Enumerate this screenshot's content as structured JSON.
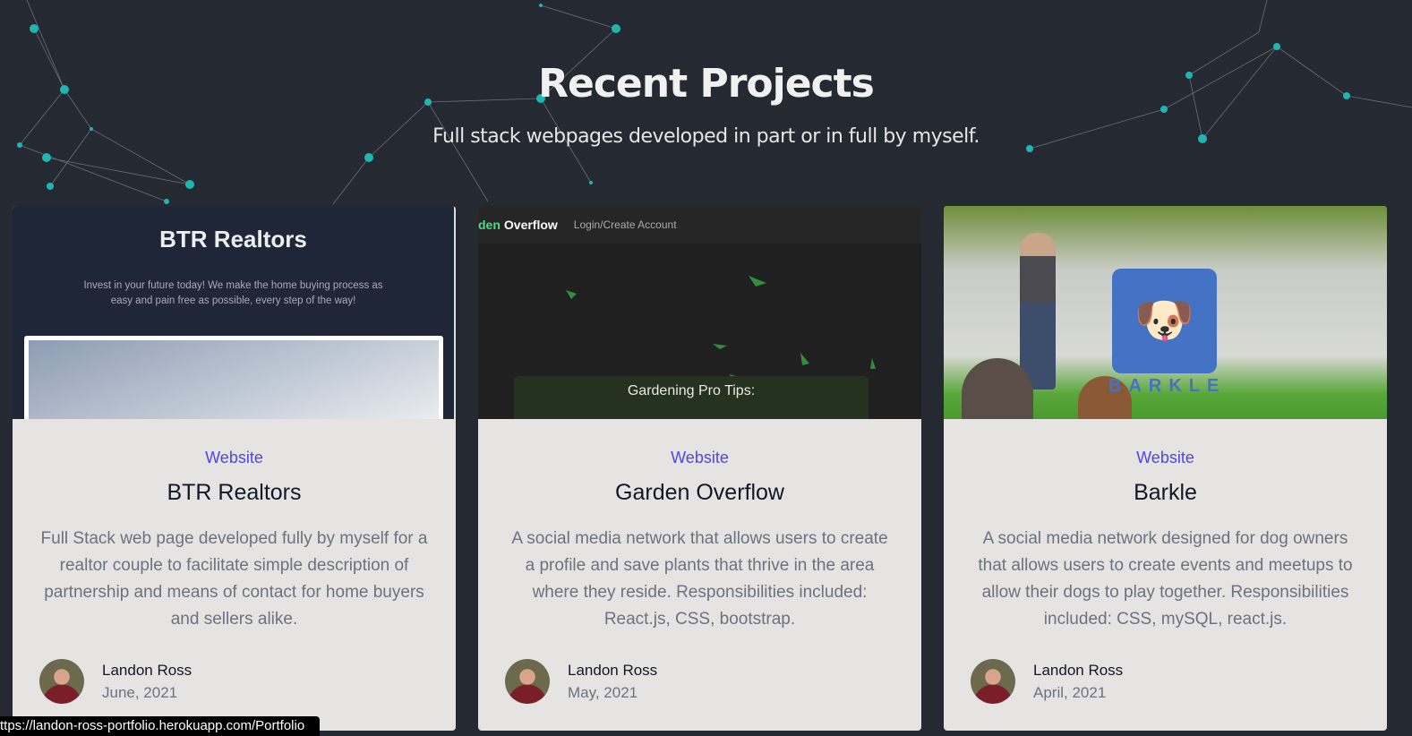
{
  "section": {
    "title": "Recent Projects",
    "subtitle": "Full stack webpages developed in part or in full by myself."
  },
  "projects": [
    {
      "category": "Website",
      "name": "BTR Realtors",
      "description": "Full Stack web page developed fully by myself for a realtor couple to facilitate simple description of partnership and means of contact for home buyers and sellers alike.",
      "author": "Landon Ross",
      "date": "June, 2021",
      "thumb": {
        "heading": "BTR Realtors",
        "text": "Invest in your future today! We make the home buying process as easy and pain free as possible, every step of the way!"
      }
    },
    {
      "category": "Website",
      "name": "Garden Overflow",
      "description": "A social media network that allows users to create a profile and save plants that thrive in the area where they reside. Responsibilities included: React.js, CSS, bootstrap.",
      "author": "Landon Ross",
      "date": "May, 2021",
      "thumb": {
        "brand_green": "den",
        "brand_white": "Overflow",
        "nav": "Login/Create Account",
        "box": "Gardening Pro Tips:"
      }
    },
    {
      "category": "Website",
      "name": "Barkle",
      "description": "A social media network designed for dog owners that allows users to create events and meetups to allow their dogs to play together. Responsibilities included: CSS, mySQL, react.js.",
      "author": "Landon Ross",
      "date": "April, 2021",
      "thumb": {
        "logo_text": "BARKLE"
      }
    }
  ],
  "status_bar": "ttps://landon-ross-portfolio.herokuapp.com/Portfolio",
  "colors": {
    "accent": "#4f46e5",
    "node": "#1fb5b5",
    "background": "#252932"
  }
}
